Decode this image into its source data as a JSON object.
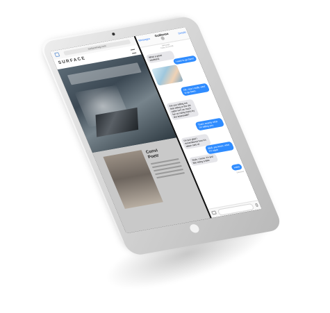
{
  "browser": {
    "url": "surfacemag.com",
    "site_logo": "SURFACE",
    "article_title": "Convi\nPoetr"
  },
  "messages": {
    "back_label": "Messages",
    "contact_name": "Guillermo",
    "details_label": "Details",
    "timestamp": "iMessage\nToday 10:13 AM",
    "thread": [
      {
        "side": "in",
        "text": "What a great weekend."
      },
      {
        "side": "out",
        "text": "I want to go there!"
      },
      {
        "side": "out",
        "text": "OK, now I really want to go there."
      },
      {
        "side": "in",
        "text": "Are you telling me that sitting in the old cabin isn't as much fun as riding trains by the boardwalk?"
      },
      {
        "side": "out",
        "text": "That's exactly what I'm telling you."
      },
      {
        "side": "in",
        "text": "I'm just glad I remembered how it's taken care of."
      },
      {
        "side": "out",
        "text": "Well, you know, what I'm sayin"
      },
      {
        "side": "in",
        "text": "Yeah, I know. It's just like riding a bike"
      },
      {
        "side": "out",
        "text": "Haha"
      }
    ],
    "delivered_label": "Delivered"
  }
}
